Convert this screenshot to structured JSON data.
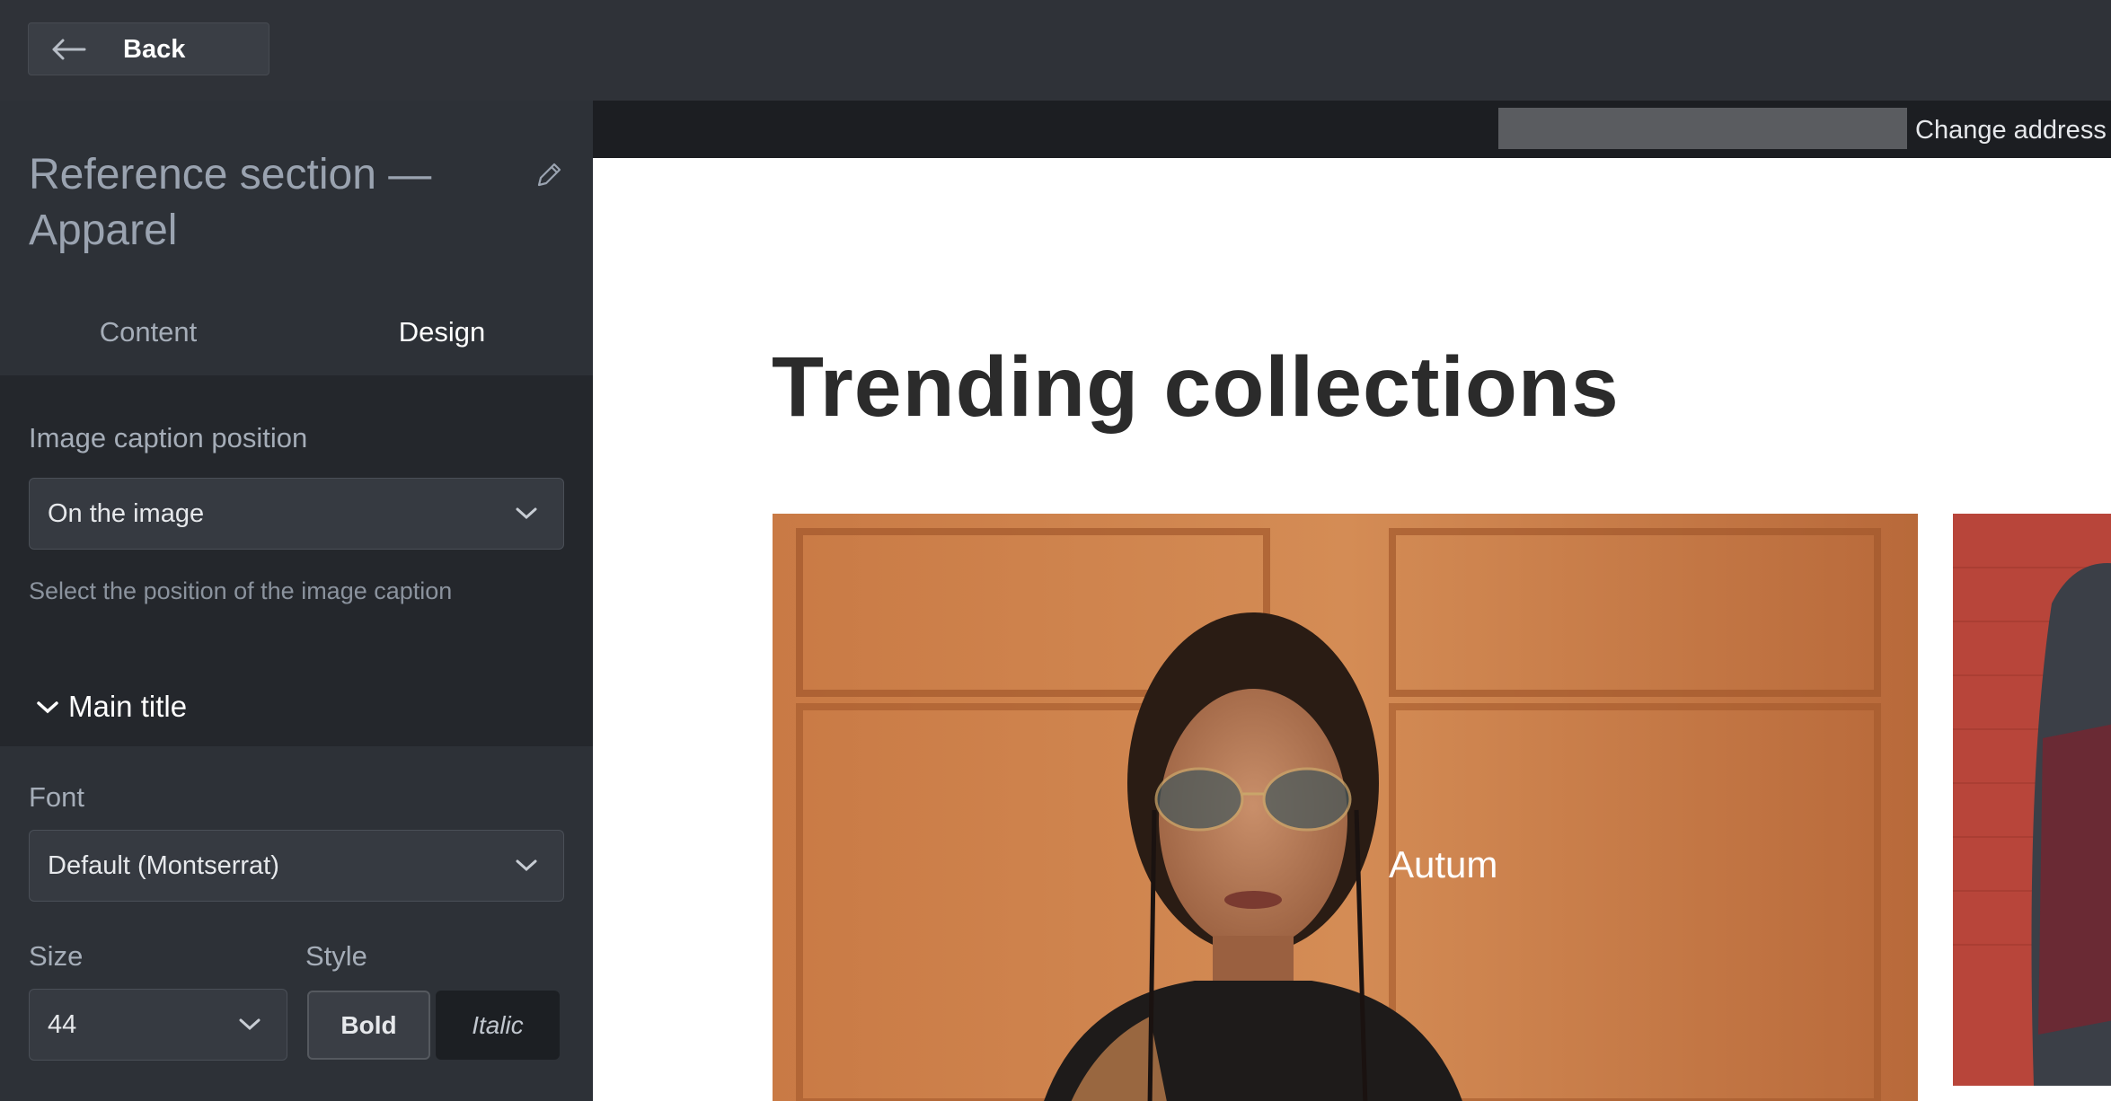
{
  "header": {
    "back_label": "Back"
  },
  "sidebar": {
    "section_title": "Reference section — Apparel",
    "tabs": [
      {
        "label": "Content",
        "active": false
      },
      {
        "label": "Design",
        "active": true
      }
    ],
    "image_caption": {
      "label": "Image caption position",
      "value": "On the image",
      "helper": "Select the position of the image caption"
    },
    "main_title_group": "Main title",
    "font": {
      "label": "Font",
      "value": "Default (Montserrat)"
    },
    "size": {
      "label": "Size",
      "value": "44"
    },
    "style": {
      "label": "Style",
      "bold_label": "Bold",
      "italic_label": "Italic"
    }
  },
  "preview": {
    "change_address_label": "Change address",
    "title": "Trending collections",
    "side_card_caption": "Autum"
  },
  "colors": {
    "sidebar_bg": "#2d3137",
    "panel_bg": "#24272c",
    "preview_bg": "#ffffff",
    "accent_text": "#ffffff"
  }
}
